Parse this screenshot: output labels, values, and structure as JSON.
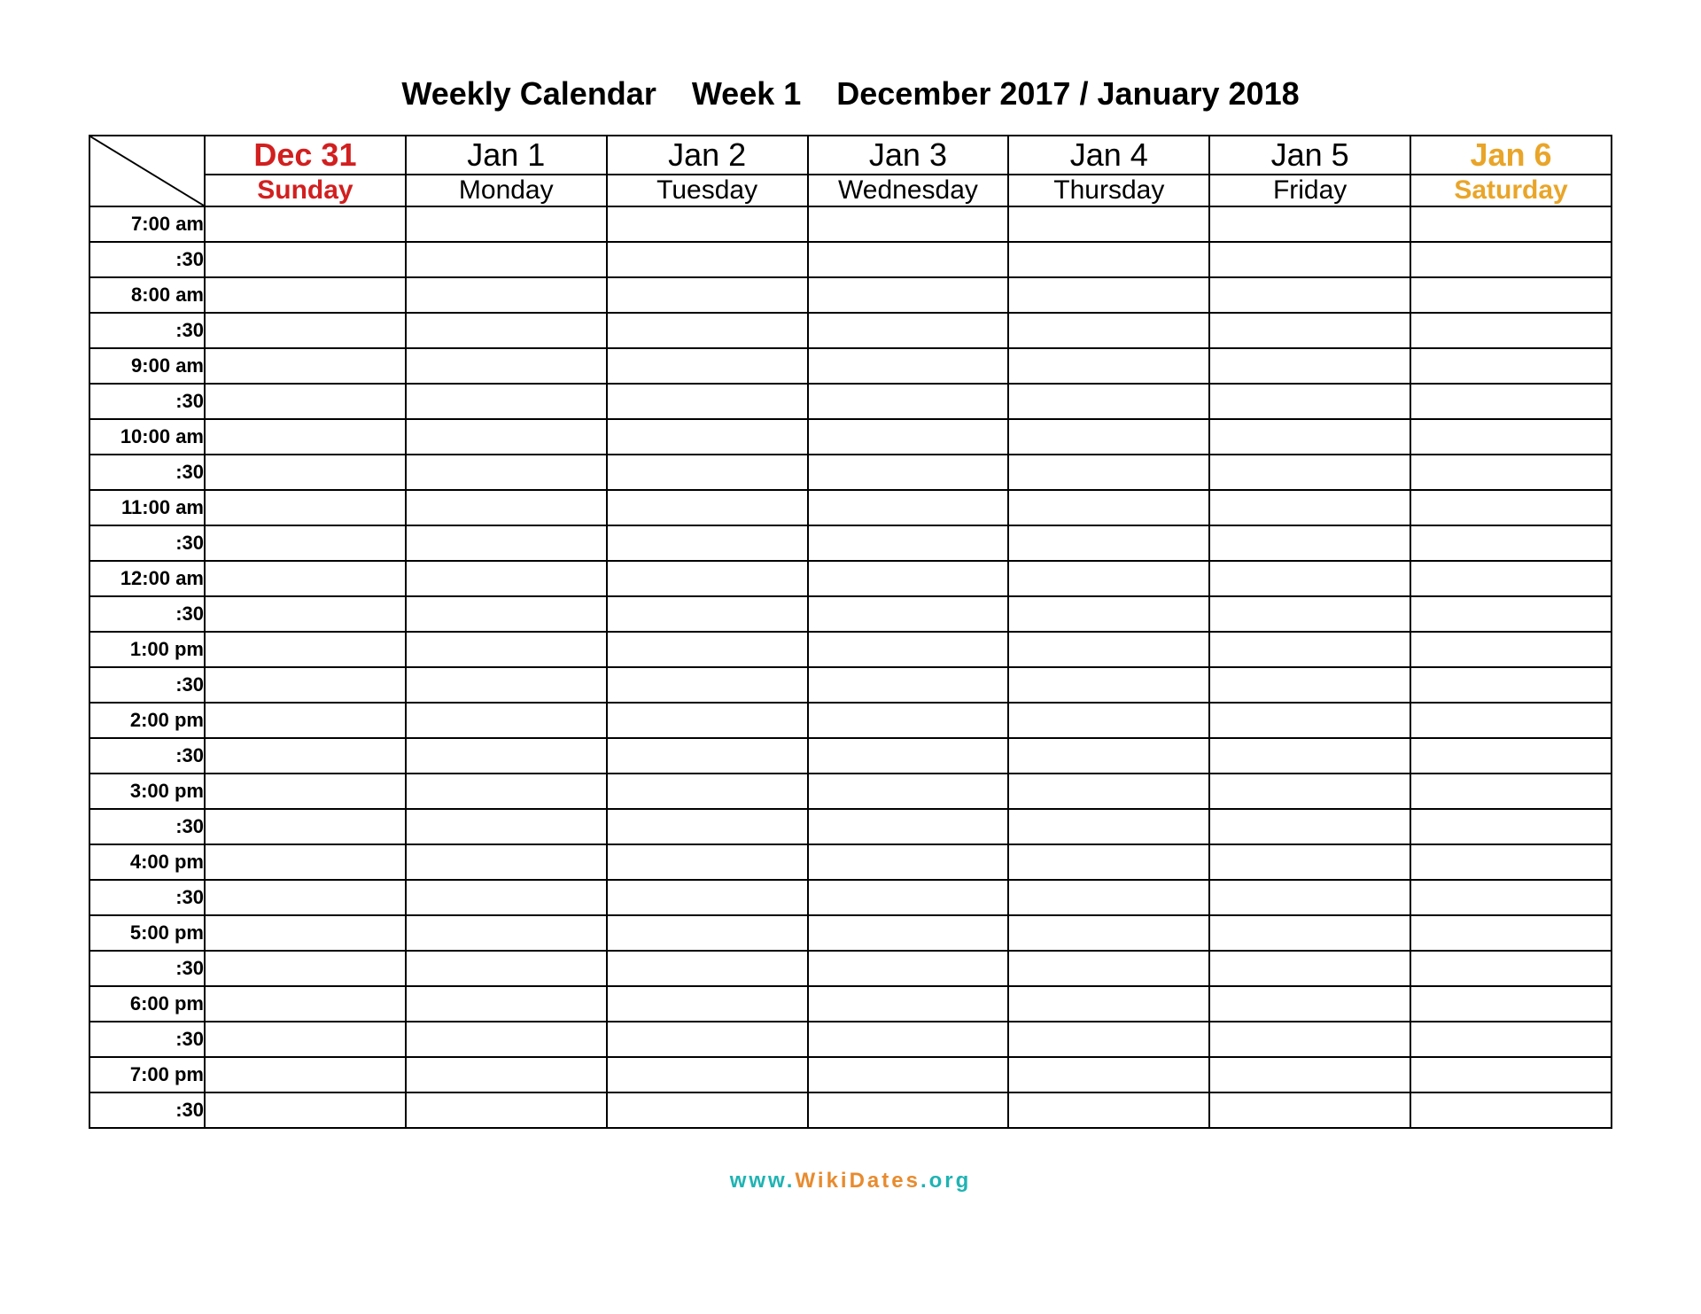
{
  "title": "Weekly Calendar    Week 1    December 2017 / January 2018",
  "days": [
    {
      "date": "Dec 31",
      "name": "Sunday",
      "style": "sun"
    },
    {
      "date": "Jan 1",
      "name": "Monday",
      "style": ""
    },
    {
      "date": "Jan 2",
      "name": "Tuesday",
      "style": ""
    },
    {
      "date": "Jan 3",
      "name": "Wednesday",
      "style": ""
    },
    {
      "date": "Jan 4",
      "name": "Thursday",
      "style": ""
    },
    {
      "date": "Jan 5",
      "name": "Friday",
      "style": ""
    },
    {
      "date": "Jan 6",
      "name": "Saturday",
      "style": "sat"
    }
  ],
  "times": [
    "7:00 am",
    ":30",
    "8:00 am",
    ":30",
    "9:00 am",
    ":30",
    "10:00 am",
    ":30",
    "11:00 am",
    ":30",
    "12:00 am",
    ":30",
    "1:00 pm",
    ":30",
    "2:00 pm",
    ":30",
    "3:00 pm",
    ":30",
    "4:00 pm",
    ":30",
    "5:00 pm",
    ":30",
    "6:00 pm",
    ":30",
    "7:00 pm",
    ":30"
  ],
  "footer": {
    "prefix": "www.",
    "main": "WikiDates",
    "suffix": ".org"
  }
}
